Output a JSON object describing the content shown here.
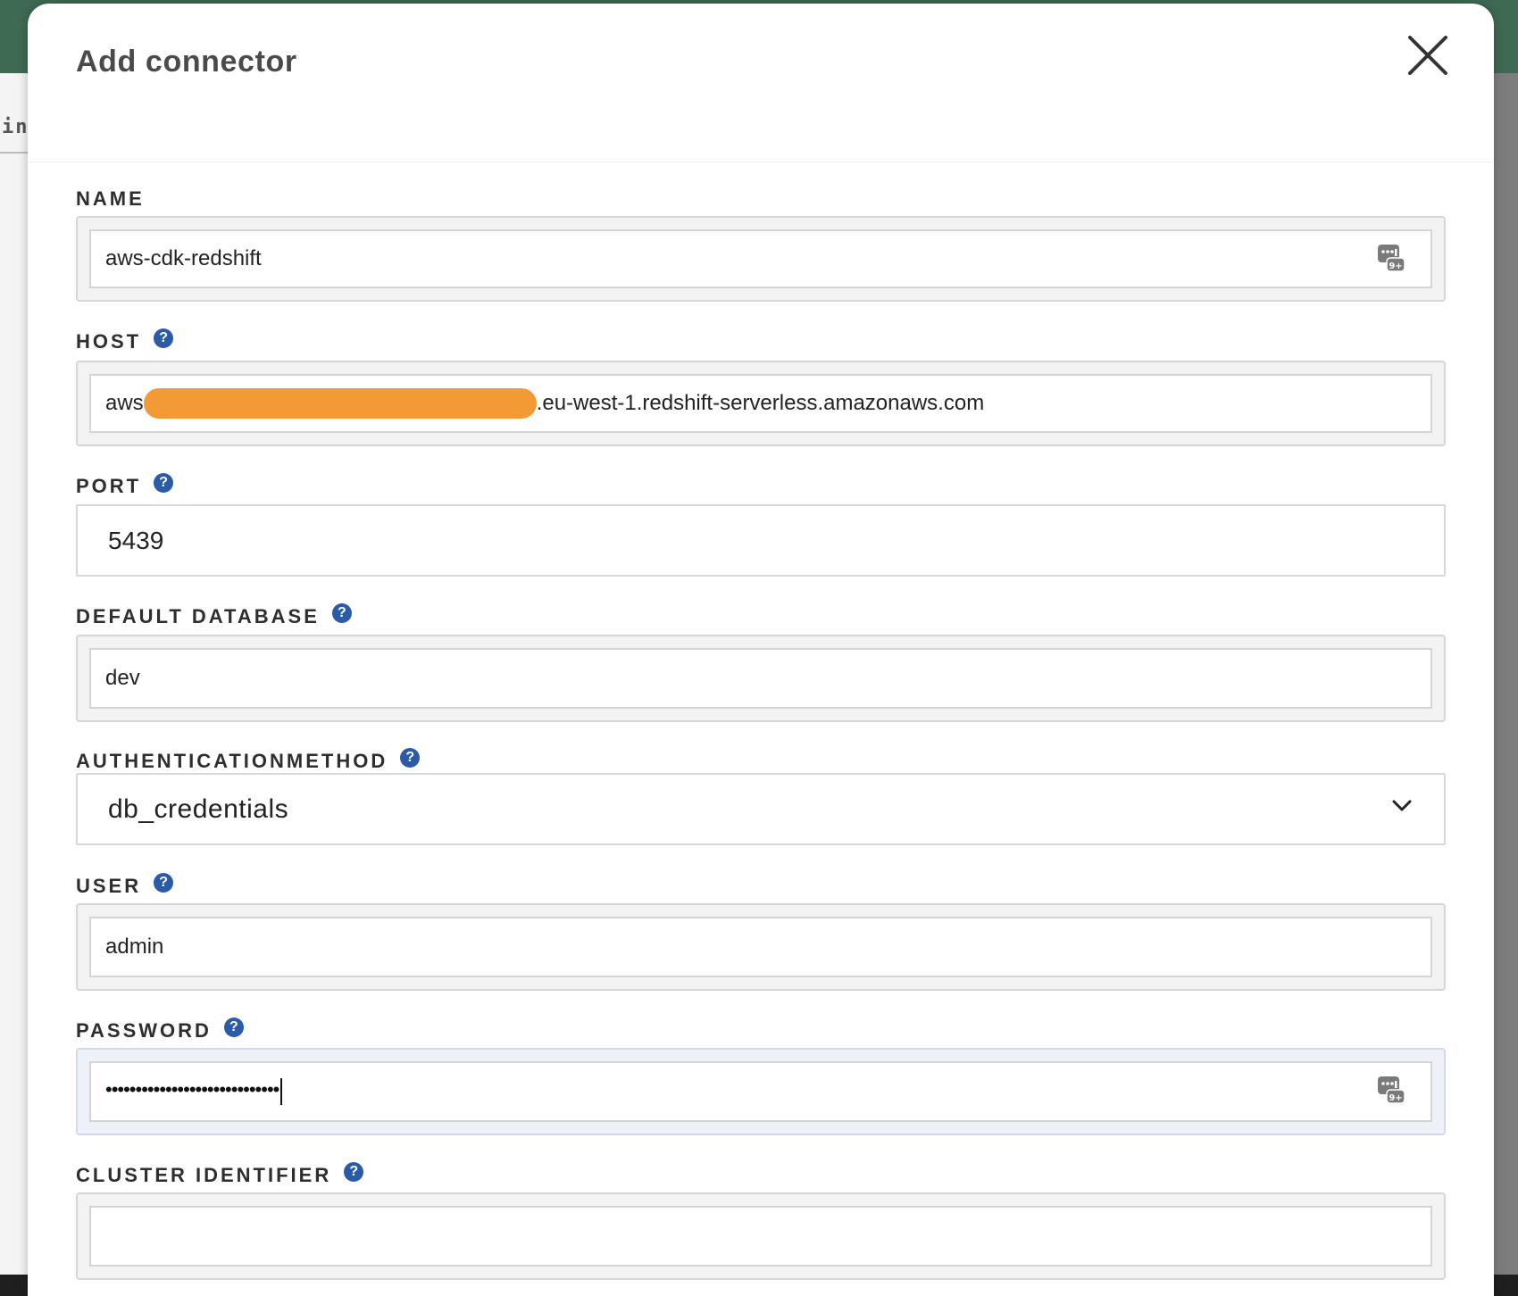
{
  "background": {
    "left_text": "in."
  },
  "modal": {
    "title": "Add connector"
  },
  "fields": {
    "name": {
      "label": "NAME",
      "value": "aws-cdk-redshift"
    },
    "host": {
      "label": "HOST",
      "value_prefix": "aws",
      "value_suffix": ".eu-west-1.redshift-serverless.amazonaws.com"
    },
    "port": {
      "label": "PORT",
      "value": "5439"
    },
    "default_database": {
      "label": "DEFAULT DATABASE",
      "value": "dev"
    },
    "authentication_method": {
      "label": "AUTHENTICATIONMETHOD",
      "value": "db_credentials"
    },
    "user": {
      "label": "USER",
      "value": "admin"
    },
    "password": {
      "label": "PASSWORD",
      "masked_value": "•••••••••••••••••••••••••••••"
    },
    "cluster_identifier": {
      "label": "CLUSTER IDENTIFIER",
      "value": ""
    }
  },
  "icons": {
    "help": "?",
    "help_color": "#2a5aa8",
    "redaction_color": "#f29a36"
  }
}
